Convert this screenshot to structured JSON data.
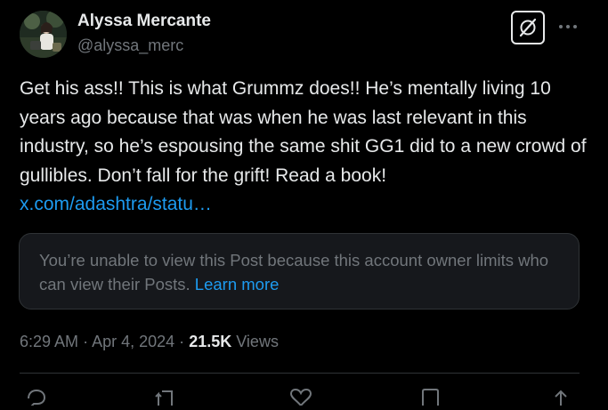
{
  "user": {
    "display_name": "Alyssa Mercante",
    "handle": "@alyssa_merc"
  },
  "icons": {
    "grok": "grok-icon",
    "more": "more-icon",
    "reply": "reply-icon",
    "repost": "repost-icon",
    "like": "like-icon",
    "bookmark": "bookmark-icon",
    "share": "share-icon"
  },
  "tweet": {
    "text": "Get his ass!! This is what Grummz does!!  He’s mentally living 10 years ago because that was when he was last relevant in this industry, so he’s espousing the same shit GG1 did to a new crowd of gullibles. Don’t fall for the grift! Read a book!",
    "link": "x.com/adashtra/statu…"
  },
  "quote": {
    "message": "You’re unable to view this Post because this account owner limits who can view their Posts.",
    "link_label": "Learn more"
  },
  "meta": {
    "time": "6:29 AM",
    "separator": "·",
    "date": "Apr 4, 2024",
    "views_count": "21.5K",
    "views_label": "Views"
  },
  "colors": {
    "background": "#000000",
    "text": "#e7e9ea",
    "muted": "#71767b",
    "link": "#1d9bf0",
    "card_background": "#16181c",
    "border": "#2f3336"
  }
}
